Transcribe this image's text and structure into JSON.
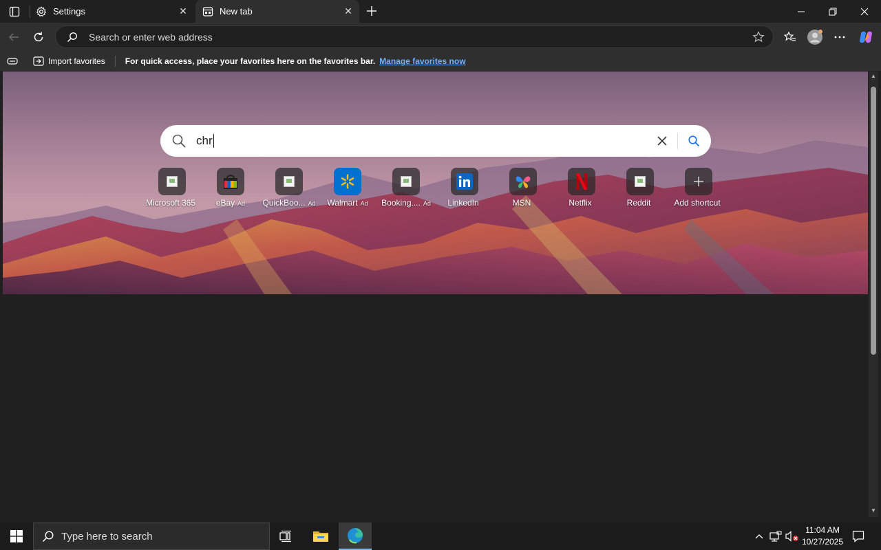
{
  "browser": {
    "tabs": [
      {
        "label": "Settings",
        "icon": "gear-icon",
        "active": false
      },
      {
        "label": "New tab",
        "icon": "newtab-page-icon",
        "active": true
      }
    ],
    "address_bar": {
      "placeholder": "Search or enter web address",
      "value": ""
    },
    "favorites_bar": {
      "import_label": "Import favorites",
      "message": "For quick access, place your favorites here on the favorites bar.",
      "link": "Manage favorites now"
    }
  },
  "new_tab": {
    "search": {
      "query": "chr"
    },
    "shortcuts": [
      {
        "name": "Microsoft 365",
        "ad": "",
        "icon": "broken-image-icon"
      },
      {
        "name": "eBay",
        "ad": "Ad",
        "icon": "ebay-bag-icon"
      },
      {
        "name": "QuickBoo...",
        "ad": "Ad",
        "icon": "broken-image-icon"
      },
      {
        "name": "Walmart",
        "ad": "Ad",
        "icon": "walmart-spark-icon"
      },
      {
        "name": "Booking....",
        "ad": "Ad",
        "icon": "broken-image-icon"
      },
      {
        "name": "LinkedIn",
        "ad": "",
        "icon": "linkedin-icon"
      },
      {
        "name": "MSN",
        "ad": "",
        "icon": "msn-butterfly-icon"
      },
      {
        "name": "Netflix",
        "ad": "",
        "icon": "netflix-icon"
      },
      {
        "name": "Reddit",
        "ad": "",
        "icon": "broken-image-icon"
      },
      {
        "name": "Add shortcut",
        "ad": "",
        "icon": "plus-icon"
      }
    ]
  },
  "taskbar": {
    "search_placeholder": "Type here to search",
    "time": "11:04 AM",
    "date": "10/27/2025"
  },
  "colors": {
    "accent": "#76b9ed",
    "link": "#6cb4ff",
    "page_bg": "#202020",
    "toolbar_bg": "#2f2f2f"
  }
}
